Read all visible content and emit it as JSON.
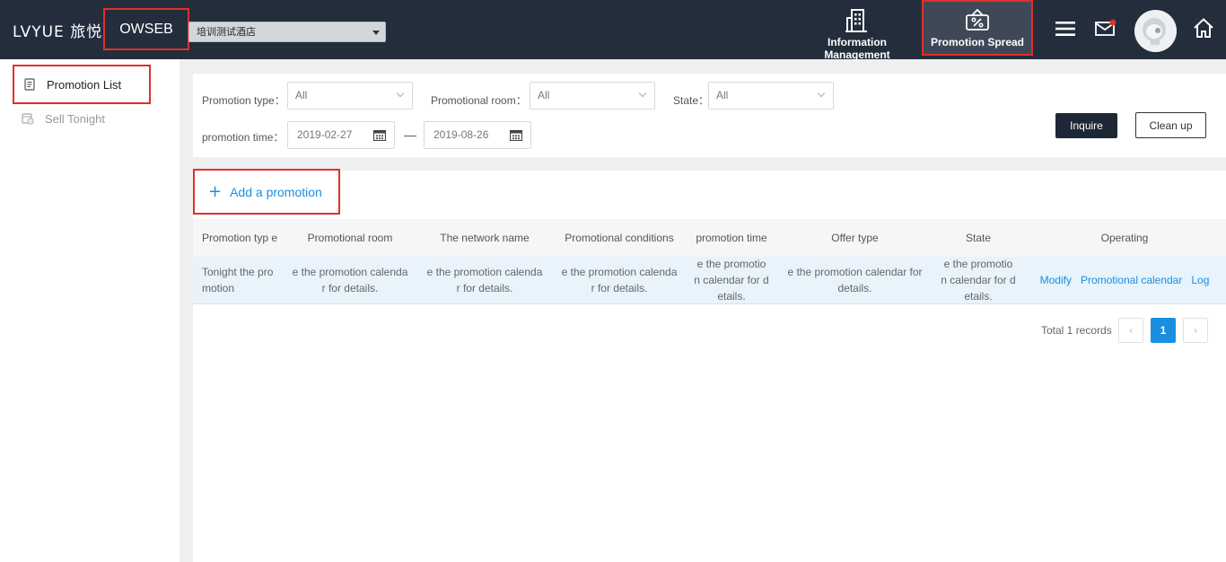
{
  "header": {
    "logo_text": "LVYUE 旅悦",
    "brand": "OWSEB",
    "hotel_select": "培训测试酒店",
    "nav": {
      "info": "Information Management",
      "promo": "Promotion Spread"
    },
    "icons": [
      "building-icon",
      "ticket-percent-icon",
      "menu-icon",
      "mail-icon",
      "avatar",
      "home-icon"
    ],
    "accent_color": "#e0302a",
    "bar_color": "#232d3b"
  },
  "sidebar": {
    "items": [
      {
        "label": "Promotion List",
        "active": true
      },
      {
        "label": "Sell Tonight",
        "active": false
      }
    ]
  },
  "filters": {
    "type_label": "Promotion type：",
    "type_value": "All",
    "room_label": "Promotional room：",
    "room_value": "All",
    "state_label": "State：",
    "state_value": "All",
    "time_label": "promotion time：",
    "date_from": "2019-02-27",
    "date_sep": "—",
    "date_to": "2019-08-26",
    "inquire": "Inquire",
    "clean": "Clean up"
  },
  "main": {
    "add_label": "Add a promotion",
    "table": {
      "headers": [
        "Promotion typ e",
        "Promotional room",
        "The network name",
        "Promotional conditions",
        "promotion time",
        "Offer type",
        "State",
        "Operating"
      ],
      "rows": [
        {
          "type": "Tonight the pro motion",
          "room": "e the promotion calenda r for details.",
          "network": "e the promotion calenda r for details.",
          "conditions": "e the promotion calenda r for details.",
          "time": "e the promotio n calendar for d etails.",
          "offer": "e the promotion calendar for details.",
          "state": "e the promotio n calendar for d etails.",
          "ops": [
            "Modify",
            "Promotional calendar",
            "Log"
          ]
        }
      ]
    },
    "pagination": {
      "total": "Total 1 records",
      "current": "1",
      "prev": "‹",
      "next": "›"
    },
    "link_color": "#1a8fe0"
  }
}
